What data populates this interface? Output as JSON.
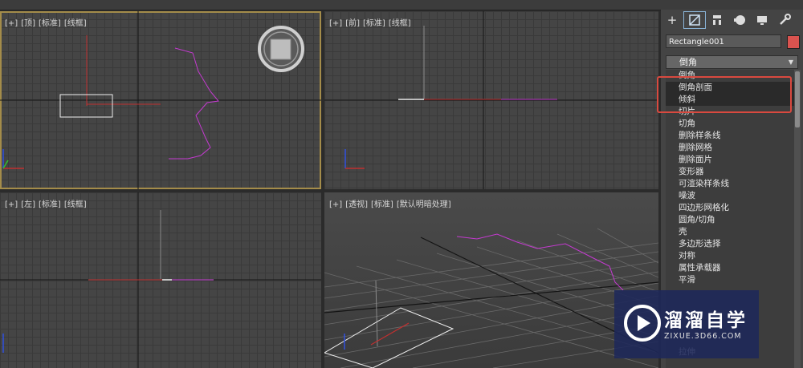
{
  "viewports": {
    "top": {
      "labels": [
        "[+]",
        "[顶]",
        "[标准]",
        "[线框]"
      ]
    },
    "front": {
      "labels": [
        "[+]",
        "[前]",
        "[标准]",
        "[线框]"
      ]
    },
    "left": {
      "labels": [
        "[+]",
        "[左]",
        "[标准]",
        "[线框]"
      ]
    },
    "perspective": {
      "labels": [
        "[+]",
        "[透视]",
        "[标准]",
        "[默认明暗处理]"
      ]
    }
  },
  "command_panel": {
    "tabs": [
      "create-icon",
      "modify-icon",
      "hierarchy-icon",
      "motion-icon",
      "display-icon",
      "utilities-icon"
    ],
    "object_name": "Rectangle001",
    "object_color": "#d9534f",
    "modifier_dropdown": "倒角",
    "modifier_list": [
      "倒角",
      "倒角剖面",
      "倾斜",
      "切片",
      "切角",
      "删除样条线",
      "删除网格",
      "删除面片",
      "变形器",
      "可渲染样条线",
      "噪波",
      "四边形网格化",
      "圆角/切角",
      "壳",
      "多边形选择",
      "对称",
      "属性承载器",
      "平滑",
      "",
      "",
      "",
      "",
      "",
      "拉伸"
    ],
    "highlighted_items": [
      1,
      2
    ]
  },
  "watermark": {
    "brand": "溜溜自学",
    "url": "ZIXUE.3D66.COM"
  },
  "colors": {
    "annotation_box": "#d9493f",
    "active_viewport": "#a48c4a"
  }
}
